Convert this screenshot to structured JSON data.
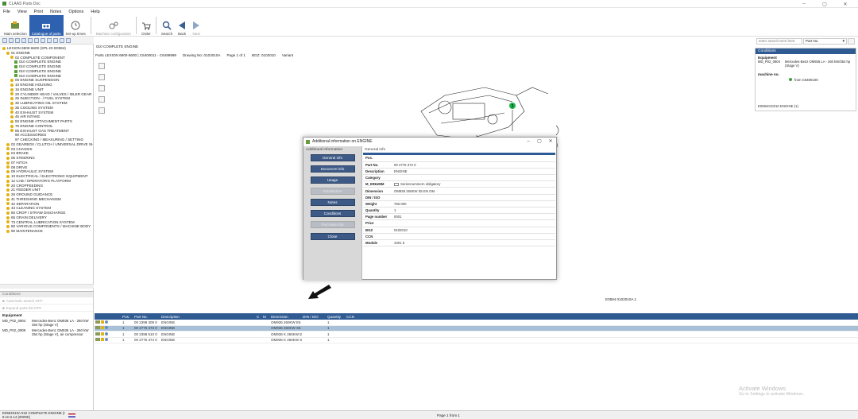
{
  "window": {
    "title": "CLAAS Parts Doc"
  },
  "menu": [
    "File",
    "View",
    "Print",
    "Notes",
    "Options",
    "Help"
  ],
  "toolbar": {
    "main_selection": "Main selection",
    "catalogue_of_parts": "Catalogue of parts",
    "set_up_times": "Set-up times",
    "machine_configuration": "Machine configuration",
    "order": "Order",
    "search": "Search",
    "back": "Back",
    "next": "Next"
  },
  "header": {
    "catalogue_line": "LEXION 6900-6600 (SPL-ID E0594)",
    "assembly_title": "010 COMPLETE ENGINE",
    "parts_info": "Parts LEXION 6900-6600 | C6400011 - C6499999",
    "drawing_no": "Drawing No: 0102010A",
    "page": "Page 1 of 1",
    "bgz": "BGZ: 0102010",
    "variant": "Variant"
  },
  "tree": [
    {
      "label": "LEXION 6900-6600 (SPL-ID E0594)",
      "level": 0,
      "icon": "dot"
    },
    {
      "label": "01 ENGINE",
      "level": 1,
      "icon": "dot"
    },
    {
      "label": "02 COMPLETE COMPONENT",
      "level": 2,
      "icon": "dot"
    },
    {
      "label": "010 COMPLETE ENGINE",
      "level": 3,
      "icon": "green",
      "selected": true
    },
    {
      "label": "010 COMPLETE ENGINE",
      "level": 3,
      "icon": "green"
    },
    {
      "label": "010 COMPLETE ENGINE",
      "level": 3,
      "icon": "green"
    },
    {
      "label": "010 COMPLETE ENGINE",
      "level": 3,
      "icon": "green"
    },
    {
      "label": "05 ENGINE SUSPENSION",
      "level": 2,
      "icon": "dot"
    },
    {
      "label": "10 ENGINE HOUSING",
      "level": 2,
      "icon": "dot"
    },
    {
      "label": "15 ENGINE UNIT",
      "level": 2,
      "icon": "dot"
    },
    {
      "label": "20 CYLINDER HEAD / VALVES / IDLER GEAR",
      "level": 2,
      "icon": "dot"
    },
    {
      "label": "25 INJECTION - / FUEL SYSTEM",
      "level": 2,
      "icon": "dot"
    },
    {
      "label": "30 LUBRICATING OIL SYSTEM",
      "level": 2,
      "icon": "dot"
    },
    {
      "label": "35 COOLING SYSTEM",
      "level": 2,
      "icon": "dot"
    },
    {
      "label": "40 EXHAUST SYSTEM",
      "level": 2,
      "icon": "dot"
    },
    {
      "label": "45 AIR INTAKE",
      "level": 2,
      "icon": "dot"
    },
    {
      "label": "50 ENGINE ATTACHMENT PARTS",
      "level": 2,
      "icon": "dot"
    },
    {
      "label": "75 ENGINE CONTROL",
      "level": 2,
      "icon": "dot"
    },
    {
      "label": "85 EXHAUST GAS TREATMENT",
      "level": 2,
      "icon": "dot"
    },
    {
      "label": "90 ACCESSORIES",
      "level": 2,
      "icon": "none"
    },
    {
      "label": "97 CHECKING / MEASURING / SETTING",
      "level": 2,
      "icon": "none"
    },
    {
      "label": "02 GEARBOX / CLUTCH / UNIVERSAL DRIVE SHAF",
      "level": 1,
      "icon": "dot"
    },
    {
      "label": "03 CHASSIS",
      "level": 1,
      "icon": "dot"
    },
    {
      "label": "04 BRAKE",
      "level": 1,
      "icon": "dot"
    },
    {
      "label": "05 STEERING",
      "level": 1,
      "icon": "dot"
    },
    {
      "label": "07 HITCH",
      "level": 1,
      "icon": "dot"
    },
    {
      "label": "08 DRIVE",
      "level": 1,
      "icon": "dot"
    },
    {
      "label": "09 HYDRAULIC SYSTEM",
      "level": 1,
      "icon": "dot"
    },
    {
      "label": "10 ELECTRICAL / ELECTRONIC EQUIPMENT",
      "level": 1,
      "icon": "dot"
    },
    {
      "label": "12 CAB / OPERATOR'S PLATFORM",
      "level": 1,
      "icon": "dot"
    },
    {
      "label": "20 CROPFEEDING",
      "level": 1,
      "icon": "dot"
    },
    {
      "label": "21 FEEDER UNIT",
      "level": 1,
      "icon": "dot"
    },
    {
      "label": "26 GROUND GUIDANCE",
      "level": 1,
      "icon": "dot"
    },
    {
      "label": "41 THRESHING MECHANISM",
      "level": 1,
      "icon": "dot"
    },
    {
      "label": "42 SEPARATION",
      "level": 1,
      "icon": "dot"
    },
    {
      "label": "43 CLEANING SYSTEM",
      "level": 1,
      "icon": "dot"
    },
    {
      "label": "60 CROP / STRAW DISCHARGE",
      "level": 1,
      "icon": "dot"
    },
    {
      "label": "65 GRAIN DELIVERY",
      "level": 1,
      "icon": "dot"
    },
    {
      "label": "73 CENTRAL LUBRICATION SYSTEM",
      "level": 1,
      "icon": "dot"
    },
    {
      "label": "80 VARIOUS COMPONENTS / MACHINE BODY",
      "level": 1,
      "icon": "dot"
    },
    {
      "label": "90 MAINTENANCE",
      "level": 1,
      "icon": "dot"
    }
  ],
  "conditions_left": {
    "header": "Conditions",
    "automatic_search": "Automatic search OFF",
    "expand_parts": "Expand parts list OFF",
    "equipment_label": "Equipment",
    "rows": [
      {
        "code": "MD_P02_0904",
        "desc": "Mercedes-Benz OM936 LA - 260 kW 354 hp (Stage V)"
      },
      {
        "code": "MD_P02_0909",
        "desc": "Mercedes-Benz OM936 LA - 260 kW 354 hp (Stage V), air compressor"
      }
    ]
  },
  "search": {
    "placeholder": "enter search term here",
    "field": "Part No."
  },
  "conditions_right": {
    "header": "Conditions",
    "equipment_label": "Equipment",
    "eq_code": "MD_P02_0904",
    "eq_desc": "Mercedes-Benz OM936 LA - 260 kW/354 hp (Stage V)",
    "machine_label": "machine no.",
    "machine_value": "from C6400100",
    "footer": "E0594010210 ENGINE (1)"
  },
  "drawing": {
    "caption": "E0594 0102010A 1",
    "callout": "3"
  },
  "dialog": {
    "title": "Additional information on ENGINE",
    "left_header": "Additional information",
    "right_header": "General info",
    "buttons": [
      {
        "label": "General info",
        "enabled": true
      },
      {
        "label": "Document info",
        "enabled": true
      },
      {
        "label": "Usage",
        "enabled": true
      },
      {
        "label": "Substitution",
        "enabled": false
      },
      {
        "label": "Notes",
        "enabled": true
      },
      {
        "label": "Conditions",
        "enabled": true
      },
      {
        "label": "Purchase info",
        "enabled": false
      }
    ],
    "close": "Close",
    "fields": [
      {
        "k": "Pos.",
        "v": ""
      },
      {
        "k": "Part No.",
        "v": "00 2775 373 0"
      },
      {
        "k": "Description",
        "v": "ENGINE"
      },
      {
        "k": "Category",
        "v": ""
      },
      {
        "k": "M_EINUMM",
        "v": "Seriennummern obligatory"
      },
      {
        "k": "Dimension",
        "v": "OM936 260KW S5 EN OM"
      },
      {
        "k": "DIN / ISO",
        "v": ""
      },
      {
        "k": "Weight",
        "v": "750.000"
      },
      {
        "k": "Quantity",
        "v": "1"
      },
      {
        "k": "Page number",
        "v": "0001"
      },
      {
        "k": "Price",
        "v": ""
      },
      {
        "k": "BGZ",
        "v": "0102010"
      },
      {
        "k": "CCN",
        "v": ""
      },
      {
        "k": "Module",
        "v": "1001 5"
      }
    ]
  },
  "grid": {
    "columns": [
      "",
      "Pos.",
      "Part No.",
      "Description",
      "C",
      "M",
      "Dimension",
      "DIN / ISO",
      "Quantity",
      "CCN"
    ],
    "rows": [
      {
        "pos": "1",
        "part": "00 2398 309 0",
        "desc": "ENGINE",
        "dim": "OM936 260KW E5",
        "qty": "1",
        "selected": false
      },
      {
        "pos": "1",
        "part": "00 2775 373 0",
        "desc": "ENGINE",
        "dim": "OM936 260KW S5",
        "qty": "1",
        "selected": true
      },
      {
        "pos": "1",
        "part": "00 2398 510 0",
        "desc": "ENGINE",
        "dim": "OM936 K 260KW E",
        "qty": "1",
        "selected": false
      },
      {
        "pos": "1",
        "part": "00 2775 374 0",
        "desc": "ENGINE",
        "dim": "OM936 K 260KW S",
        "qty": "1",
        "selected": false
      }
    ]
  },
  "status": {
    "left1": "E0594010A 010 COMPLETE ENGINE (I",
    "left2": "8.10.2.14 (0009K)",
    "page": "Page 1 from 1"
  },
  "watermark": {
    "line1": "Activate Windows",
    "line2": "Go to Settings to activate Windows."
  },
  "colors": {
    "accent": "#2f5a92",
    "tree_dot": "#e3b20f",
    "tree_green": "#58a23a",
    "selected_row": "#a7c0d8"
  }
}
